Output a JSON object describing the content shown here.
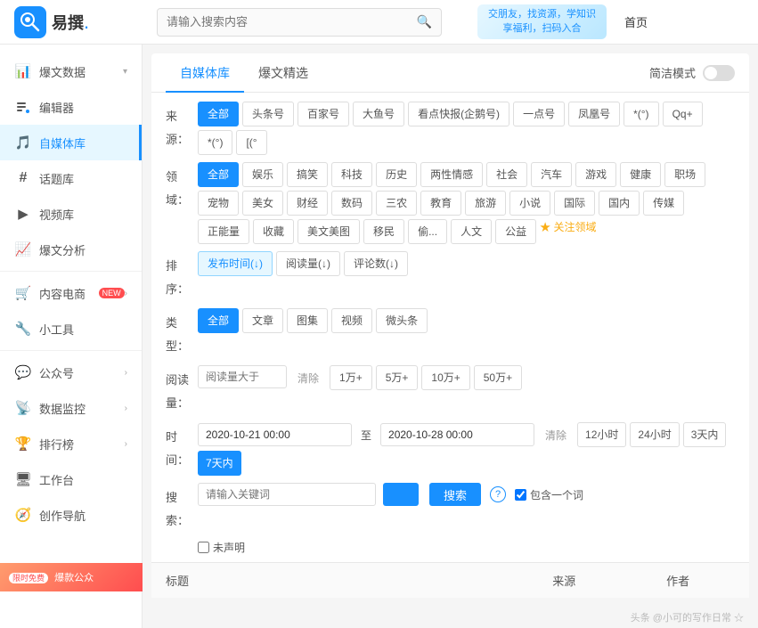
{
  "header": {
    "logo_text": "易撰",
    "logo_dot": ".",
    "search_placeholder": "请输入搜索内容",
    "banner_line1": "交朋友，找资源，学知识",
    "banner_line2": "享福利，扫码入合",
    "nav_home": "首页"
  },
  "sidebar": {
    "items": [
      {
        "id": "baowendata",
        "label": "爆文数据",
        "icon": "📊",
        "has_chevron": true,
        "active": false
      },
      {
        "id": "bianji",
        "label": "编辑器",
        "icon": "✏️",
        "has_chevron": false,
        "active": false
      },
      {
        "id": "zimeiti",
        "label": "自媒体库",
        "icon": "🎵",
        "has_chevron": false,
        "active": true
      },
      {
        "id": "huatiku",
        "label": "话题库",
        "icon": "#",
        "has_chevron": false,
        "active": false
      },
      {
        "id": "shipin",
        "label": "视频库",
        "icon": "▶",
        "has_chevron": false,
        "active": false
      },
      {
        "id": "baowen-fenxi",
        "label": "爆文分析",
        "icon": "📈",
        "has_chevron": false,
        "active": false
      },
      {
        "id": "neirong",
        "label": "内容电商",
        "icon": "🛒",
        "has_chevron": false,
        "active": false,
        "badge": "NEW"
      },
      {
        "id": "xiaogongju",
        "label": "小工具",
        "icon": "🔧",
        "has_chevron": false,
        "active": false
      },
      {
        "id": "gongzhonghao",
        "label": "公众号",
        "icon": "💬",
        "has_chevron": false,
        "active": false,
        "has_chevron2": true
      },
      {
        "id": "shujujiankong",
        "label": "数据监控",
        "icon": "📡",
        "has_chevron": false,
        "active": false,
        "has_chevron2": true
      },
      {
        "id": "paihangbang",
        "label": "排行榜",
        "icon": "🏆",
        "has_chevron": false,
        "active": false,
        "has_chevron2": true
      },
      {
        "id": "gongtai",
        "label": "工作台",
        "icon": "🖥",
        "has_chevron": false,
        "active": false
      },
      {
        "id": "chuangzuo",
        "label": "创作导航",
        "icon": "🧭",
        "has_chevron": false,
        "active": false
      }
    ],
    "promo_badge": "限时免费",
    "promo_text": "爆款公众"
  },
  "main": {
    "tabs": [
      {
        "id": "zimeiti-tab",
        "label": "自媒体库",
        "active": true
      },
      {
        "id": "baowenjingxuan-tab",
        "label": "爆文精选",
        "active": false
      },
      {
        "id": "jianjie-tab",
        "label": "简洁模式",
        "active": false,
        "is_toggle": true
      }
    ],
    "filters": {
      "source_label": "来源：",
      "source_options": [
        {
          "label": "全部",
          "active": true
        },
        {
          "label": "头条号",
          "active": false
        },
        {
          "label": "百家号",
          "active": false
        },
        {
          "label": "大鱼号",
          "active": false
        },
        {
          "label": "看点快报(企鹅号)",
          "active": false
        },
        {
          "label": "一点号",
          "active": false
        },
        {
          "label": "凤凰号",
          "active": false
        },
        {
          "label": "*(°)",
          "active": false
        },
        {
          "label": "Qq+",
          "active": false
        },
        {
          "label": "*(°)",
          "active": false
        },
        {
          "label": "[(°",
          "active": false
        }
      ],
      "domain_label": "领域：",
      "domain_options": [
        {
          "label": "全部",
          "active": true
        },
        {
          "label": "娱乐",
          "active": false
        },
        {
          "label": "搞笑",
          "active": false
        },
        {
          "label": "科技",
          "active": false
        },
        {
          "label": "历史",
          "active": false
        },
        {
          "label": "两性情感",
          "active": false
        },
        {
          "label": "社会",
          "active": false
        },
        {
          "label": "汽车",
          "active": false
        },
        {
          "label": "游戏",
          "active": false
        },
        {
          "label": "健康",
          "active": false
        },
        {
          "label": "职场",
          "active": false
        },
        {
          "label": "宠物",
          "active": false
        },
        {
          "label": "美女",
          "active": false
        },
        {
          "label": "财经",
          "active": false
        },
        {
          "label": "数码",
          "active": false
        },
        {
          "label": "三农",
          "active": false
        },
        {
          "label": "教育",
          "active": false
        },
        {
          "label": "旅游",
          "active": false
        },
        {
          "label": "小说",
          "active": false
        },
        {
          "label": "国际",
          "active": false
        },
        {
          "label": "国内",
          "active": false
        },
        {
          "label": "传媒",
          "active": false
        },
        {
          "label": "正能量",
          "active": false
        },
        {
          "label": "收藏",
          "active": false
        },
        {
          "label": "美文美图",
          "active": false
        },
        {
          "label": "移民",
          "active": false
        },
        {
          "label": "偷...",
          "active": false
        },
        {
          "label": "人文",
          "active": false
        },
        {
          "label": "公益",
          "active": false
        }
      ],
      "attention_link": "★ 关注领域",
      "sort_label": "排序：",
      "sort_options": [
        {
          "label": "发布时间(↓)",
          "active": true
        },
        {
          "label": "阅读量(↓)",
          "active": false
        },
        {
          "label": "评论数(↓)",
          "active": false
        }
      ],
      "type_label": "类型：",
      "type_options": [
        {
          "label": "全部",
          "active": true
        },
        {
          "label": "文章",
          "active": false
        },
        {
          "label": "图集",
          "active": false
        },
        {
          "label": "视频",
          "active": false
        },
        {
          "label": "微头条",
          "active": false
        }
      ],
      "read_label": "阅读量：",
      "read_placeholder": "阅读量大于",
      "read_options": [
        {
          "label": "清除"
        },
        {
          "label": "1万+"
        },
        {
          "label": "5万+"
        },
        {
          "label": "10万+"
        },
        {
          "label": "50万+"
        }
      ],
      "time_label": "时间：",
      "time_start": "2020-10-21 00:00",
      "time_end": "2020-10-28 00:00",
      "time_options": [
        {
          "label": "清除"
        },
        {
          "label": "12小时"
        },
        {
          "label": "24小时"
        },
        {
          "label": "3天内"
        },
        {
          "label": "7天内",
          "active": true
        }
      ],
      "search_label": "搜索：",
      "search_placeholder": "请输入关键词",
      "search_btn": "搜索",
      "include_label": "包含一个词",
      "undeclared_label": "未声明"
    },
    "table_headers": [
      {
        "label": "标题"
      },
      {
        "label": "来源"
      },
      {
        "label": "作者"
      }
    ]
  },
  "watermark": "头条 @小可的写作日常 ☆"
}
